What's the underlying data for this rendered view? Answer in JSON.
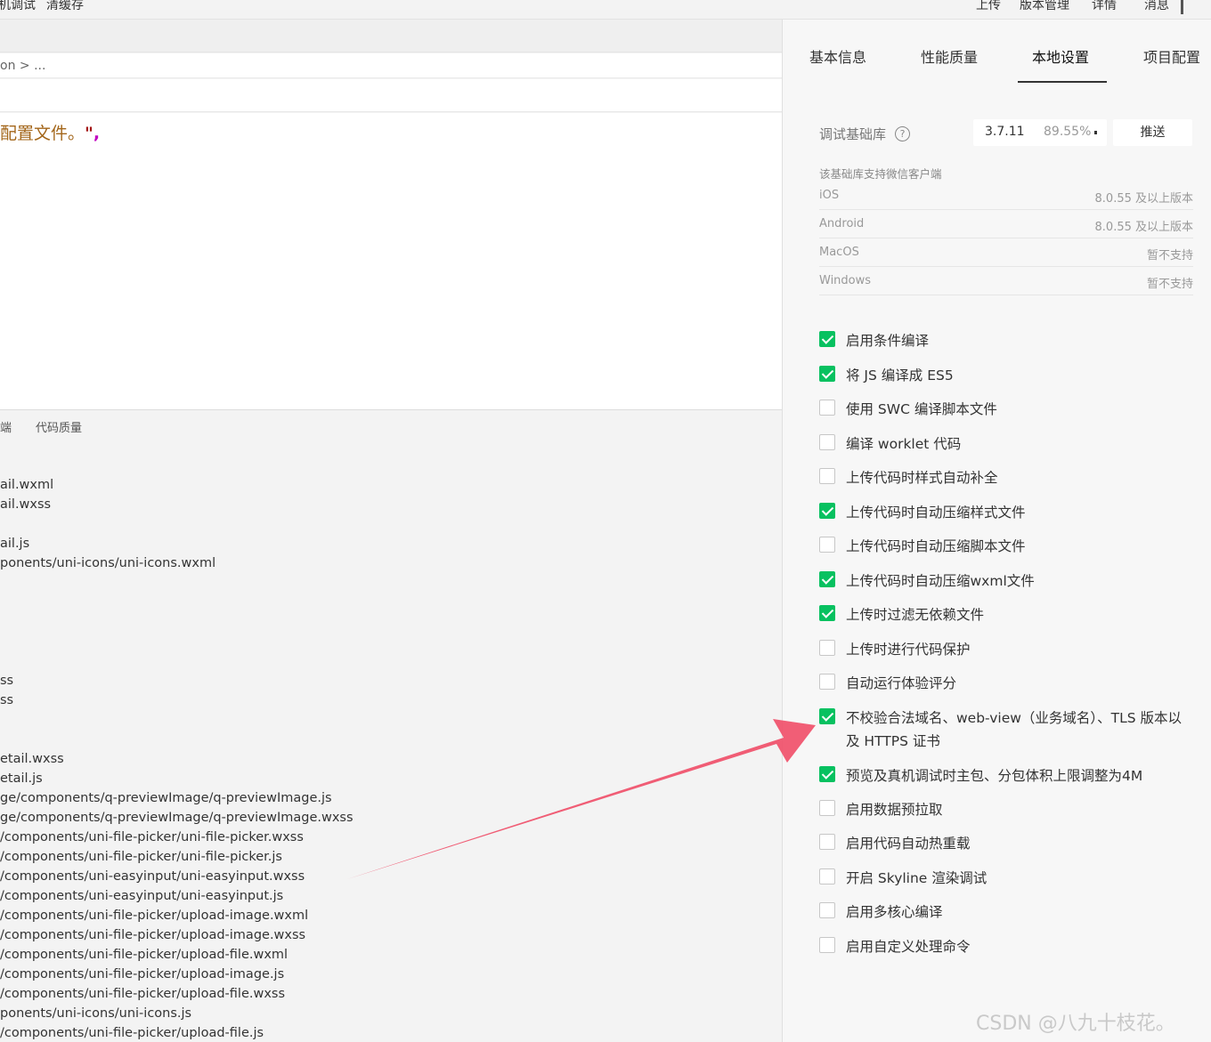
{
  "toolbar": {
    "left_items": [
      "机调试",
      "清缓存"
    ],
    "right_items": [
      "上传",
      "版本管理",
      "详情",
      "消息"
    ]
  },
  "editor": {
    "breadcrumb": "on > ...",
    "code_text": "配置文件。",
    "code_quote": "\"",
    "code_comma": ","
  },
  "lower_panel": {
    "tabs": [
      "端",
      "代码质量"
    ],
    "files": [
      "ail.wxml",
      "ail.wxss",
      "ail.js",
      "ponents/uni-icons/uni-icons.wxml",
      "ss",
      "ss",
      "etail.wxss",
      "etail.js",
      "ge/components/q-previewImage/q-previewImage.js",
      "ge/components/q-previewImage/q-previewImage.wxss",
      "/components/uni-file-picker/uni-file-picker.wxss",
      "/components/uni-file-picker/uni-file-picker.js",
      "/components/uni-easyinput/uni-easyinput.wxss",
      "/components/uni-easyinput/uni-easyinput.js",
      "/components/uni-file-picker/upload-image.wxml",
      "/components/uni-file-picker/upload-image.wxss",
      "/components/uni-file-picker/upload-file.wxml",
      "/components/uni-file-picker/upload-image.js",
      "/components/uni-file-picker/upload-file.wxss",
      "ponents/uni-icons/uni-icons.js",
      "/components/uni-file-picker/upload-file.js"
    ]
  },
  "settings": {
    "tabs": [
      "基本信息",
      "性能质量",
      "本地设置",
      "项目配置"
    ],
    "active_tab": "本地设置",
    "lib": {
      "label": "调试基础库",
      "help_icon": "?",
      "version": "3.7.11",
      "percent": "89.55%",
      "push_label": "推送"
    },
    "support_title": "该基础库支持微信客户端",
    "support": [
      {
        "platform": "iOS",
        "value": "8.0.55 及以上版本"
      },
      {
        "platform": "Android",
        "value": "8.0.55 及以上版本"
      },
      {
        "platform": "MacOS",
        "value": "暂不支持"
      },
      {
        "platform": "Windows",
        "value": "暂不支持"
      }
    ],
    "options": [
      {
        "label": "启用条件编译",
        "checked": true
      },
      {
        "label": "将 JS 编译成 ES5",
        "checked": true
      },
      {
        "label": "使用 SWC 编译脚本文件",
        "checked": false
      },
      {
        "label": "编译 worklet 代码",
        "checked": false
      },
      {
        "label": "上传代码时样式自动补全",
        "checked": false
      },
      {
        "label": "上传代码时自动压缩样式文件",
        "checked": true
      },
      {
        "label": "上传代码时自动压缩脚本文件",
        "checked": false
      },
      {
        "label": "上传代码时自动压缩wxml文件",
        "checked": true
      },
      {
        "label": "上传时过滤无依赖文件",
        "checked": true
      },
      {
        "label": "上传时进行代码保护",
        "checked": false
      },
      {
        "label": "自动运行体验评分",
        "checked": false
      },
      {
        "label": "不校验合法域名、web-view（业务域名）、TLS 版本以及 HTTPS 证书",
        "checked": true
      },
      {
        "label": "预览及真机调试时主包、分包体积上限调整为4M",
        "checked": true
      },
      {
        "label": "启用数据预拉取",
        "checked": false
      },
      {
        "label": "启用代码自动热重载",
        "checked": false
      },
      {
        "label": "开启 Skyline 渲染调试",
        "checked": false
      },
      {
        "label": "启用多核心编译",
        "checked": false
      },
      {
        "label": "启用自定义处理命令",
        "checked": false
      }
    ]
  },
  "watermark": "CSDN @八九十枝花。",
  "colors": {
    "check_green": "#07c160",
    "arrow_red": "#f0506a"
  }
}
